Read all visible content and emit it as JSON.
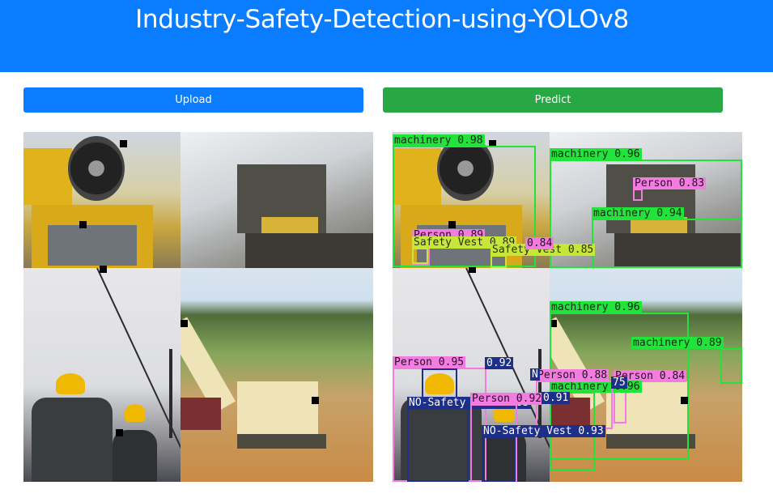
{
  "header": {
    "title": "Industry-Safety-Detection-using-YOLOv8",
    "background_color": "#0a7cff"
  },
  "toolbar": {
    "upload_label": "Upload",
    "predict_label": "Predict",
    "upload_color": "#0a7cff",
    "predict_color": "#28a745"
  },
  "input_image": {
    "description_icon": "construction-collage-image"
  },
  "prediction": {
    "detections": [
      {
        "label": "machinery 0.98"
      },
      {
        "label": "machinery 0.96"
      },
      {
        "label": "Person 0.83"
      },
      {
        "label": "machinery 0.94"
      },
      {
        "label": "Person 0.89"
      },
      {
        "label": "Safety Vest 0.89"
      },
      {
        "label": "Safety Vest 0.85"
      },
      {
        "label": "0.84"
      },
      {
        "label": "machinery 0.96"
      },
      {
        "label": "machinery 0.89"
      },
      {
        "label": "Person 0.95"
      },
      {
        "label": "0.92"
      },
      {
        "label": "Person 0.88"
      },
      {
        "label": "machinery 0.96"
      },
      {
        "label": "Person 0.84"
      },
      {
        "label": "NO-Safety Vest 0.95"
      },
      {
        "label": "NO-Safety Vest 0.93"
      },
      {
        "label": "0.91"
      },
      {
        "label": "Person 0.92"
      },
      {
        "label": "75"
      },
      {
        "label": "N"
      }
    ]
  }
}
